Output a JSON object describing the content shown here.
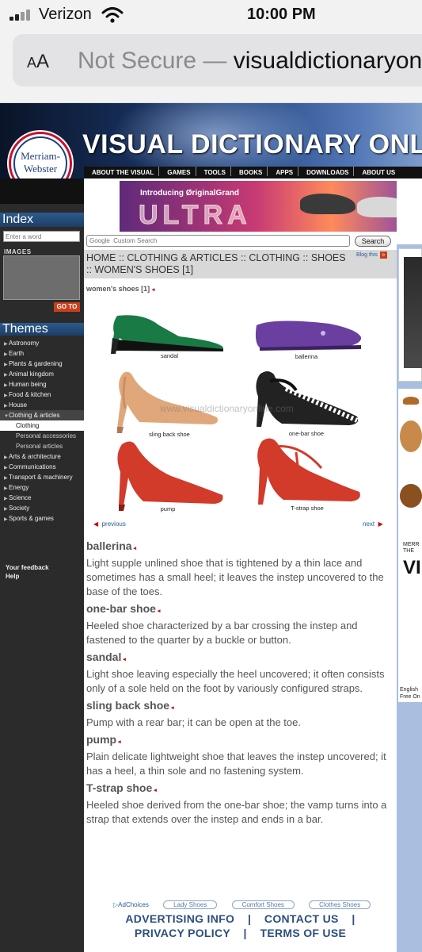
{
  "status_bar": {
    "carrier": "Verizon",
    "time": "10:00 PM"
  },
  "browser": {
    "aa_small": "A",
    "aa_large": "A",
    "security": "Not Secure",
    "separator": " — ",
    "url": "visualdictionaryonline.com"
  },
  "site": {
    "logo_line1": "Merriam-",
    "logo_line2": "Webster",
    "title": "VISUAL DICTIONARY ONLINE",
    "nav": [
      "ABOUT THE VISUAL",
      "GAMES",
      "TOOLS",
      "BOOKS",
      "APPS",
      "DOWNLOADS",
      "ABOUT US"
    ]
  },
  "sidebar": {
    "index_title": "Index",
    "word_placeholder": "Enter a word",
    "images_label": "IMAGES",
    "goto_label": "GO TO",
    "themes_title": "Themes",
    "themes": [
      {
        "label": "Astronomy",
        "kind": "item"
      },
      {
        "label": "Earth",
        "kind": "item"
      },
      {
        "label": "Plants & gardening",
        "kind": "item"
      },
      {
        "label": "Animal kingdom",
        "kind": "item"
      },
      {
        "label": "Human being",
        "kind": "item"
      },
      {
        "label": "Food & kitchen",
        "kind": "item"
      },
      {
        "label": "House",
        "kind": "item"
      },
      {
        "label": "Clothing & articles",
        "kind": "open"
      },
      {
        "label": "Clothing",
        "kind": "sub-active"
      },
      {
        "label": "Personal accessories",
        "kind": "sub"
      },
      {
        "label": "Personal articles",
        "kind": "sub"
      },
      {
        "label": "Arts & architecture",
        "kind": "item"
      },
      {
        "label": "Communications",
        "kind": "item"
      },
      {
        "label": "Transport & machinery",
        "kind": "item"
      },
      {
        "label": "Energy",
        "kind": "item"
      },
      {
        "label": "Science",
        "kind": "item"
      },
      {
        "label": "Society",
        "kind": "item"
      },
      {
        "label": "Sports & games",
        "kind": "item"
      }
    ],
    "feedback": "Your feedback",
    "help": "Help"
  },
  "ad": {
    "intro": "Introducing ØriginalGrand",
    "brand": "ULTRA"
  },
  "search": {
    "placeholder": "Google  Custom Search",
    "button": "Search"
  },
  "breadcrumb": "HOME :: CLOTHING & ARTICLES :: CLOTHING :: SHOES :: WOMEN'S SHOES [1]",
  "blog_label": "Blog this",
  "section_title": "women's shoes [1]",
  "shoes": {
    "sandal": "sandal",
    "ballerina": "ballerina",
    "sling": "sling back shoe",
    "onebar": "one-bar shoe",
    "pump": "pump",
    "tstrap": "T-strap shoe"
  },
  "watermark": "www.visualdictionaryonline.com",
  "pager": {
    "previous": "previous",
    "next": "next"
  },
  "definitions": [
    {
      "term": "ballerina",
      "text": "Light supple unlined shoe that is tightened by a thin lace and sometimes has a small heel; it leaves the instep uncovered to the base of the toes."
    },
    {
      "term": "one-bar shoe",
      "text": "Heeled shoe characterized by a bar crossing the instep and fastened to the quarter by a buckle or button."
    },
    {
      "term": "sandal",
      "text": "Light shoe leaving especially the heel uncovered; it often consists only of a sole held on the foot by variously configured straps."
    },
    {
      "term": "sling back shoe",
      "text": "Pump with a rear bar; it can be open at the toe."
    },
    {
      "term": "pump",
      "text": "Plain delicate lightweight shoe that leaves the instep uncovered; it has a heel, a thin sole and no fastening system."
    },
    {
      "term": "T-strap shoe",
      "text": "Heeled shoe derived from the one-bar shoe; the vamp turns into a strap that extends over the instep and ends in a bar."
    }
  ],
  "footer": {
    "adchoices": "AdChoices",
    "pills": [
      "Lady Shoes",
      "Comfort Shoes",
      "Clothes Shoes"
    ],
    "links_row1": "ADVERTISING INFO    |    CONTACT US    |",
    "links_row2": "PRIVACY POLICY    |    TERMS OF USE"
  },
  "right_ad": {
    "line1": "MERR",
    "line2": "THE",
    "big": "VI",
    "footer1": "English",
    "footer2": "Free On"
  }
}
